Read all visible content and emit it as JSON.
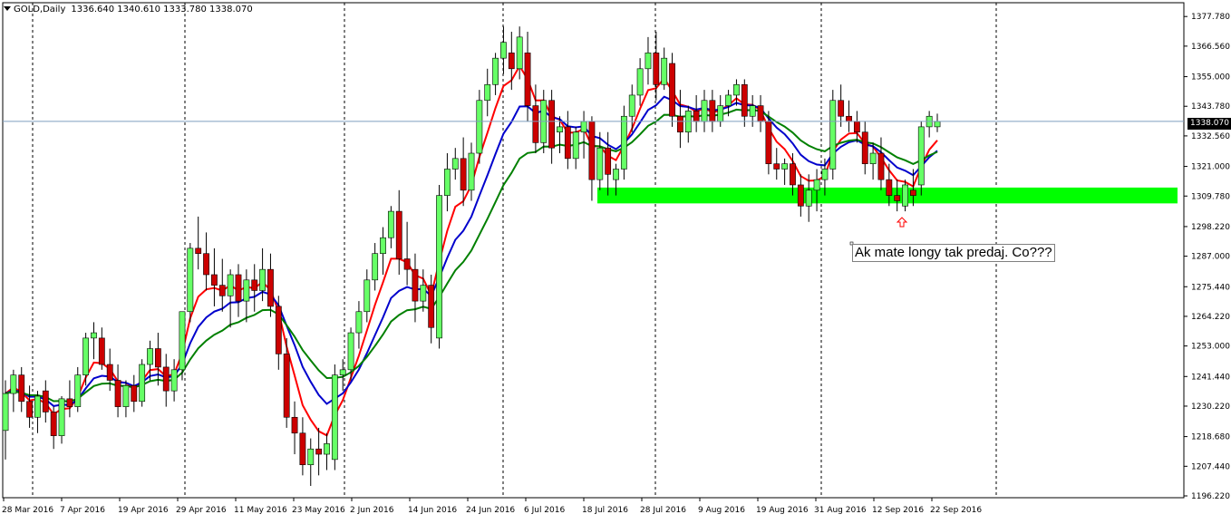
{
  "header": {
    "symbol_tf": "GOLD,Daily",
    "ohlc": "1336.640 1340.610 1333.780 1338.070"
  },
  "current_price_label": "1338.070",
  "annotation_text": "Ak mate longy tak predaj. Co???",
  "colors": {
    "background": "#ffffff",
    "bull_candle": "#66ff66",
    "bear_candle": "#cc0000",
    "ma_red": "#ff0000",
    "ma_blue": "#0000cc",
    "ma_green": "#008000",
    "support_zone": "#00ff00",
    "arrow": "#ff0000",
    "price_line": "#7f9fbf"
  },
  "chart_data": {
    "type": "candlestick",
    "title": "GOLD,Daily",
    "ylim": [
      1196.22,
      1383.0
    ],
    "y_ticks": [
      "1377.780",
      "1366.560",
      "1355.000",
      "1343.780",
      "1332.560",
      "1321.000",
      "1309.780",
      "1298.220",
      "1287.000",
      "1275.440",
      "1264.220",
      "1253.000",
      "1241.440",
      "1230.220",
      "1218.680",
      "1207.440",
      "1196.220"
    ],
    "x_ticks": [
      "28 Mar 2016",
      "7 Apr 2016",
      "19 Apr 2016",
      "29 Apr 2016",
      "11 May 2016",
      "23 May 2016",
      "2 Jun 2016",
      "14 Jun 2016",
      "24 Jun 2016",
      "6 Jul 2016",
      "18 Jul 2016",
      "28 Jul 2016",
      "9 Aug 2016",
      "19 Aug 2016",
      "31 Aug 2016",
      "12 Sep 2016",
      "22 Sep 2016"
    ],
    "support_zone": [
      1307.0,
      1313.0
    ],
    "last_price": 1338.07,
    "candles": [
      [
        1221,
        1240,
        1210,
        1235
      ],
      [
        1235,
        1244,
        1228,
        1242
      ],
      [
        1242,
        1245,
        1228,
        1232
      ],
      [
        1232,
        1238,
        1222,
        1226
      ],
      [
        1226,
        1236,
        1220,
        1234
      ],
      [
        1236,
        1240,
        1224,
        1228
      ],
      [
        1228,
        1230,
        1214,
        1219
      ],
      [
        1219,
        1234,
        1216,
        1233
      ],
      [
        1233,
        1240,
        1226,
        1230
      ],
      [
        1230,
        1245,
        1228,
        1242
      ],
      [
        1242,
        1258,
        1238,
        1256
      ],
      [
        1256,
        1262,
        1248,
        1258
      ],
      [
        1256,
        1260,
        1244,
        1246
      ],
      [
        1246,
        1252,
        1236,
        1240
      ],
      [
        1240,
        1246,
        1226,
        1230
      ],
      [
        1230,
        1240,
        1226,
        1238
      ],
      [
        1238,
        1242,
        1228,
        1232
      ],
      [
        1232,
        1248,
        1230,
        1246
      ],
      [
        1246,
        1255,
        1240,
        1252
      ],
      [
        1252,
        1258,
        1238,
        1245
      ],
      [
        1245,
        1250,
        1230,
        1236
      ],
      [
        1236,
        1248,
        1232,
        1244
      ],
      [
        1244,
        1262,
        1240,
        1266
      ],
      [
        1266,
        1292,
        1262,
        1290
      ],
      [
        1290,
        1302,
        1282,
        1288
      ],
      [
        1288,
        1296,
        1274,
        1280
      ],
      [
        1280,
        1290,
        1268,
        1276
      ],
      [
        1276,
        1286,
        1266,
        1272
      ],
      [
        1272,
        1282,
        1260,
        1280
      ],
      [
        1280,
        1284,
        1264,
        1270
      ],
      [
        1270,
        1282,
        1262,
        1278
      ],
      [
        1278,
        1284,
        1266,
        1274
      ],
      [
        1274,
        1290,
        1270,
        1282
      ],
      [
        1282,
        1288,
        1264,
        1268
      ],
      [
        1268,
        1272,
        1244,
        1250
      ],
      [
        1250,
        1256,
        1222,
        1226
      ],
      [
        1226,
        1232,
        1212,
        1220
      ],
      [
        1220,
        1226,
        1204,
        1208
      ],
      [
        1208,
        1218,
        1200,
        1214
      ],
      [
        1214,
        1222,
        1204,
        1212
      ],
      [
        1212,
        1220,
        1206,
        1216
      ],
      [
        1210,
        1246,
        1206,
        1242
      ],
      [
        1242,
        1248,
        1236,
        1244
      ],
      [
        1244,
        1260,
        1240,
        1258
      ],
      [
        1258,
        1270,
        1252,
        1266
      ],
      [
        1266,
        1282,
        1262,
        1278
      ],
      [
        1278,
        1292,
        1274,
        1288
      ],
      [
        1288,
        1298,
        1280,
        1294
      ],
      [
        1294,
        1306,
        1290,
        1304
      ],
      [
        1304,
        1312,
        1280,
        1286
      ],
      [
        1286,
        1300,
        1276,
        1282
      ],
      [
        1282,
        1288,
        1262,
        1270
      ],
      [
        1270,
        1282,
        1266,
        1276
      ],
      [
        1276,
        1280,
        1254,
        1260
      ],
      [
        1256,
        1314,
        1252,
        1310
      ],
      [
        1310,
        1326,
        1304,
        1320
      ],
      [
        1320,
        1328,
        1316,
        1324
      ],
      [
        1324,
        1332,
        1306,
        1312
      ],
      [
        1312,
        1330,
        1308,
        1326
      ],
      [
        1326,
        1350,
        1322,
        1346
      ],
      [
        1346,
        1358,
        1340,
        1352
      ],
      [
        1352,
        1364,
        1348,
        1362
      ],
      [
        1362,
        1374,
        1356,
        1368
      ],
      [
        1364,
        1372,
        1350,
        1358
      ],
      [
        1358,
        1374,
        1354,
        1370
      ],
      [
        1364,
        1372,
        1338,
        1344
      ],
      [
        1344,
        1352,
        1326,
        1330
      ],
      [
        1330,
        1350,
        1326,
        1346
      ],
      [
        1346,
        1350,
        1322,
        1328
      ],
      [
        1334,
        1340,
        1326,
        1336
      ],
      [
        1336,
        1342,
        1320,
        1324
      ],
      [
        1324,
        1336,
        1320,
        1334
      ],
      [
        1334,
        1342,
        1324,
        1338
      ],
      [
        1338,
        1340,
        1308,
        1316
      ],
      [
        1316,
        1334,
        1312,
        1328
      ],
      [
        1328,
        1334,
        1310,
        1318
      ],
      [
        1316,
        1322,
        1310,
        1320
      ],
      [
        1320,
        1344,
        1316,
        1340
      ],
      [
        1340,
        1352,
        1334,
        1348
      ],
      [
        1348,
        1362,
        1344,
        1358
      ],
      [
        1358,
        1370,
        1352,
        1364
      ],
      [
        1364,
        1372,
        1346,
        1352
      ],
      [
        1352,
        1366,
        1350,
        1362
      ],
      [
        1360,
        1364,
        1336,
        1340
      ],
      [
        1340,
        1350,
        1328,
        1334
      ],
      [
        1334,
        1344,
        1330,
        1342
      ],
      [
        1342,
        1348,
        1334,
        1338
      ],
      [
        1338,
        1350,
        1334,
        1346
      ],
      [
        1346,
        1350,
        1334,
        1338
      ],
      [
        1338,
        1348,
        1336,
        1344
      ],
      [
        1344,
        1350,
        1340,
        1348
      ],
      [
        1348,
        1354,
        1344,
        1352
      ],
      [
        1352,
        1354,
        1336,
        1340
      ],
      [
        1340,
        1348,
        1336,
        1344
      ],
      [
        1344,
        1348,
        1334,
        1338
      ],
      [
        1338,
        1342,
        1318,
        1322
      ],
      [
        1322,
        1328,
        1316,
        1320
      ],
      [
        1320,
        1324,
        1314,
        1322
      ],
      [
        1322,
        1326,
        1310,
        1314
      ],
      [
        1314,
        1318,
        1302,
        1306
      ],
      [
        1306,
        1318,
        1300,
        1312
      ],
      [
        1312,
        1320,
        1304,
        1316
      ],
      [
        1316,
        1324,
        1310,
        1320
      ],
      [
        1320,
        1350,
        1316,
        1346
      ],
      [
        1346,
        1352,
        1336,
        1340
      ],
      [
        1340,
        1346,
        1334,
        1338
      ],
      [
        1338,
        1342,
        1330,
        1334
      ],
      [
        1334,
        1338,
        1318,
        1322
      ],
      [
        1322,
        1330,
        1316,
        1326
      ],
      [
        1326,
        1332,
        1312,
        1316
      ],
      [
        1316,
        1322,
        1306,
        1310
      ],
      [
        1310,
        1316,
        1304,
        1308
      ],
      [
        1306,
        1316,
        1304,
        1314
      ],
      [
        1312,
        1320,
        1306,
        1310
      ],
      [
        1314,
        1338,
        1310,
        1336
      ],
      [
        1336,
        1342,
        1332,
        1340
      ],
      [
        1336,
        1341,
        1334,
        1338
      ]
    ]
  }
}
